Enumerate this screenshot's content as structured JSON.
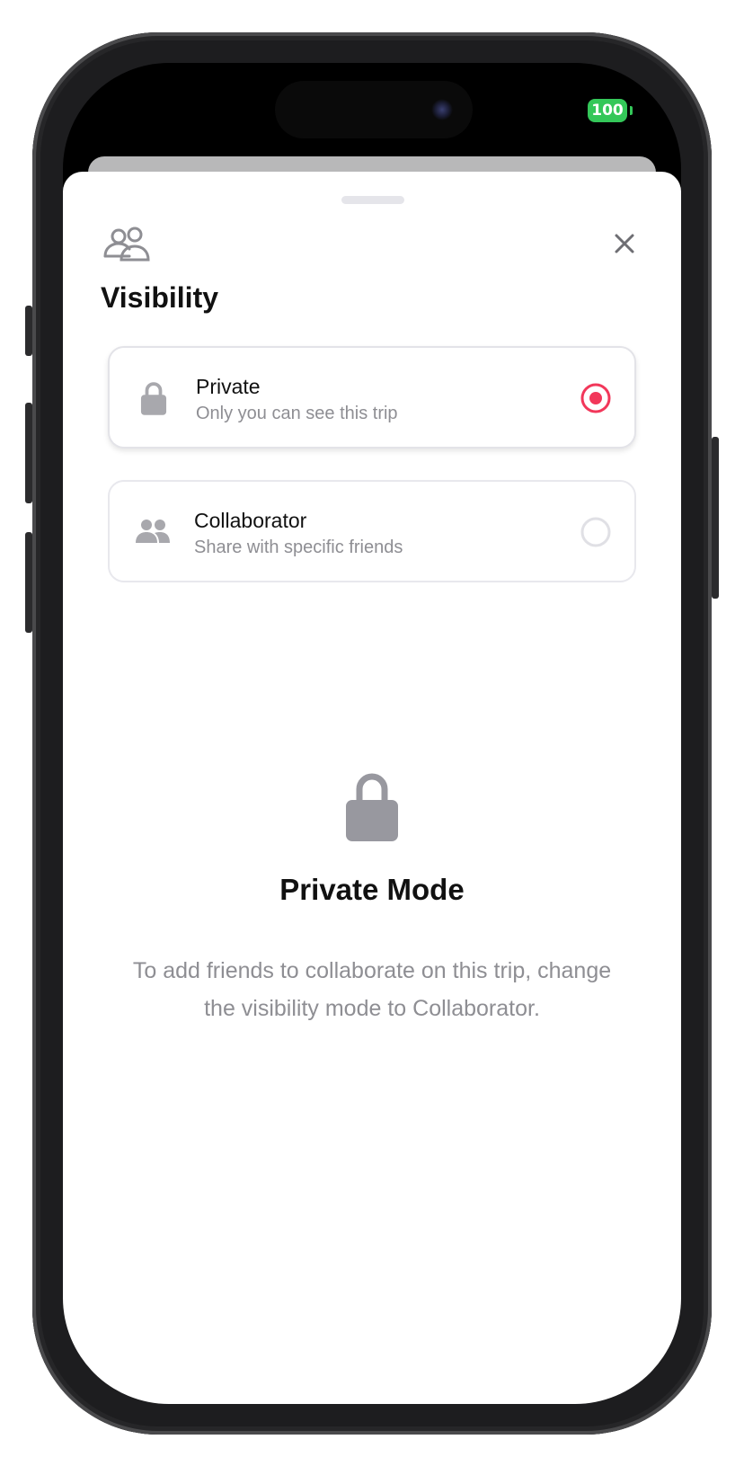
{
  "status_bar": {
    "battery": "100"
  },
  "sheet": {
    "header_icon": "people-outline-icon",
    "close_icon": "close-icon",
    "title": "Visibility"
  },
  "options": [
    {
      "icon": "lock-icon",
      "label": "Private",
      "description": "Only you can see this trip",
      "selected": true
    },
    {
      "icon": "people-icon",
      "label": "Collaborator",
      "description": "Share with specific friends",
      "selected": false
    }
  ],
  "empty_state": {
    "icon": "lock-icon",
    "title": "Private Mode",
    "description": "To add friends to collaborate on this trip, change the visibility mode to Collaborator."
  },
  "colors": {
    "accent": "#f2375a",
    "battery": "#34c759",
    "secondary_text": "#8e8e93",
    "icon_gray": "#98989f"
  }
}
